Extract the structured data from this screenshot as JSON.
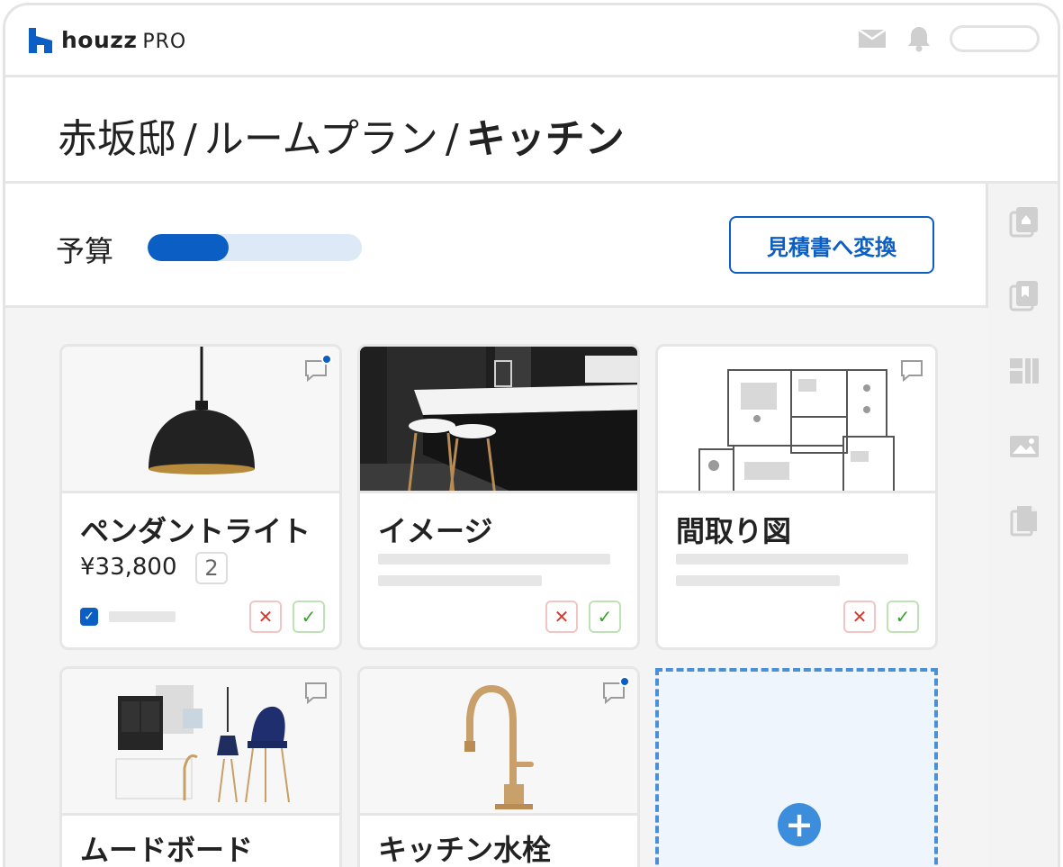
{
  "app": {
    "logo_text": "houzz",
    "logo_suffix": "PRO"
  },
  "topbar": {
    "icons": [
      "mail-icon",
      "bell-icon"
    ],
    "search_placeholder": ""
  },
  "breadcrumb": {
    "items": [
      "赤坂邸",
      "ルームプラン"
    ],
    "separator": "/",
    "current": "キッチン"
  },
  "budget": {
    "label": "予算",
    "progress_fraction": 0.38,
    "convert_button": "見積書へ変換"
  },
  "rail": {
    "icons": [
      "clipboard-icon",
      "book-icon",
      "dashboard-icon",
      "image-icon",
      "document-icon"
    ]
  },
  "cards": [
    {
      "title": "ペンダントライト",
      "price": "¥33,800",
      "quantity": "2",
      "checked": true,
      "has_new_comment": true,
      "image": "pendant-lamp"
    },
    {
      "title": "イメージ",
      "has_new_comment": false,
      "image": "kitchen-photo"
    },
    {
      "title": "間取り図",
      "has_new_comment": false,
      "image": "floor-plan"
    },
    {
      "title": "ムードボード",
      "has_new_comment": false,
      "image": "mood-board"
    },
    {
      "title": "キッチン水栓",
      "has_new_comment": true,
      "image": "faucet"
    }
  ],
  "actions": {
    "reject_symbol": "✕",
    "approve_symbol": "✓",
    "add_symbol": "+"
  },
  "colors": {
    "accent": "#0b5fc4",
    "progress_track": "#dde9f6",
    "reject": "#d23b2f",
    "approve": "#3aa329",
    "add_tile": "#3c8ddc"
  }
}
